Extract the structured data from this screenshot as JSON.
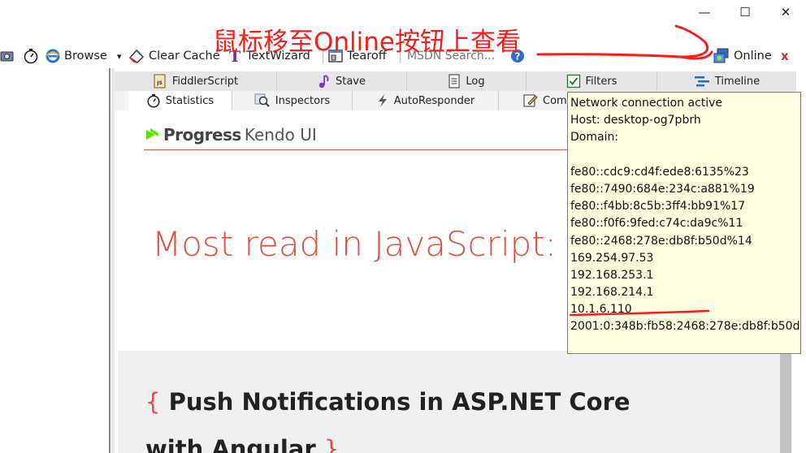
{
  "window": {
    "controls": [
      "—",
      "☐",
      "✕"
    ]
  },
  "annotation": {
    "text": "鼠标移至Online按钮上查看",
    "color": "#ff1a1a"
  },
  "toolbar": {
    "browse_label": "Browse",
    "browse_arrow": "▾",
    "clear_cache_label": "Clear Cache",
    "textwizard_label": "TextWizard",
    "tearoff_label": "Tearoff",
    "search_placeholder": "MSDN Search...",
    "help_glyph": "?",
    "online_label": "Online",
    "close_glyph": "x"
  },
  "tabs": {
    "row1": [
      "FiddlerScript",
      "Stave",
      "Log",
      "Filters",
      "Timeline"
    ],
    "row2": [
      "Statistics",
      "Inspectors",
      "AutoResponder",
      "Comp"
    ]
  },
  "content": {
    "logo_brand": "Progress",
    "logo_product": "Kendo UI",
    "headline": "Most read in JavaScript:",
    "card_open_brace": "{",
    "card_title": "Push Notifications in ASP.NET Core with Angular",
    "card_close_brace": "}"
  },
  "tooltip": {
    "status": "Network connection active",
    "host": "Host: desktop-og7pbrh",
    "domain": "Domain:",
    "addresses": [
      "fe80::cdc9:cd4f:ede8:6135%23",
      "fe80::7490:684e:234c:a881%19",
      "fe80::f4bb:8c5b:3ff4:bb91%17",
      "fe80::f0f6:9fed:c74c:da9c%11",
      "fe80::2468:278e:db8f:b50d%14",
      "169.254.97.53",
      "192.168.253.1",
      "192.168.214.1",
      "10.1.6.110",
      "2001:0:348b:fb58:2468:278e:db8f:b50d"
    ]
  },
  "colors": {
    "accent_red": "#e74c3c",
    "tooltip_bg": "#ffffe1",
    "annotation_red": "#ff1a1a"
  }
}
